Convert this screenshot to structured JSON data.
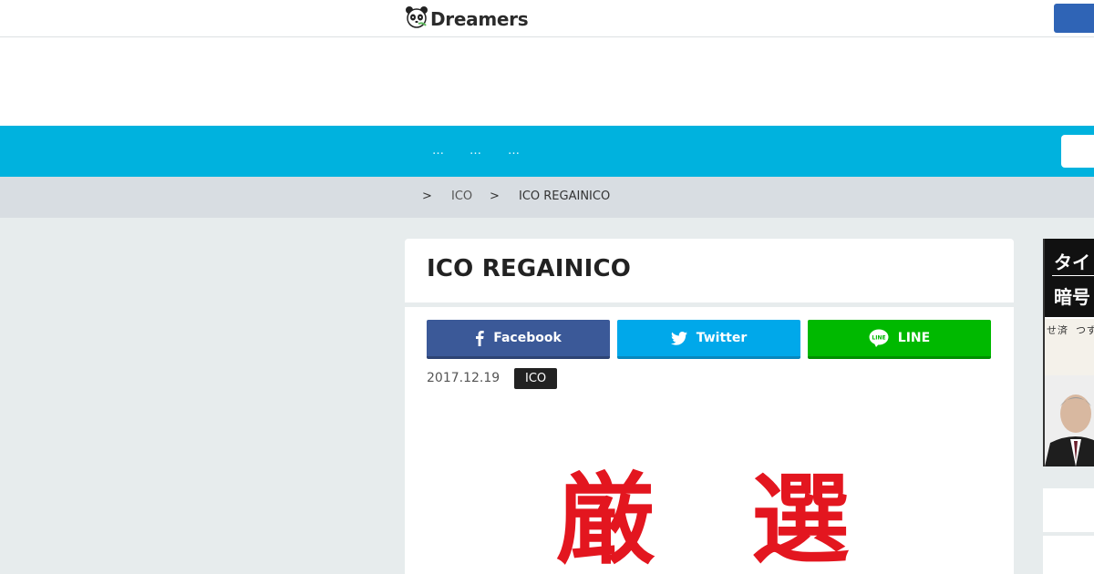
{
  "header": {
    "logo_text": "Dreamers"
  },
  "nav": {
    "items": [
      "…",
      "…",
      "…"
    ]
  },
  "breadcrumb": {
    "sep1": ">",
    "category": "ICO",
    "sep2": ">",
    "current": "ICO REGAINICO"
  },
  "article": {
    "title": "ICO REGAINICO",
    "share": {
      "facebook": "Facebook",
      "twitter": "Twitter",
      "line": "LINE"
    },
    "date": "2017.12.19",
    "category": "ICO",
    "hero_text": [
      "厳",
      "選"
    ]
  },
  "sidebar": {
    "banner_lines": [
      "タイ",
      "暗号"
    ],
    "banner_subtext": [
      "ず",
      "つ",
      "済",
      "せ"
    ]
  },
  "colors": {
    "nav": "#00b2de",
    "facebook": "#3b5998",
    "twitter": "#00a8ea",
    "line": "#00b900",
    "hero": "#e3161f"
  }
}
